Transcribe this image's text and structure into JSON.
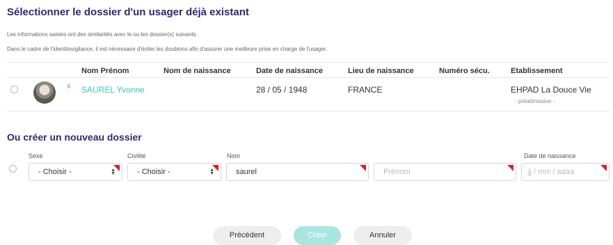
{
  "select_section": {
    "title": "Sélectionner le dossier d'un usager déjà existant",
    "info_line1": "Les informations saisies ont des similarités avec le ou les dossier(s) suivants.",
    "info_line2": "Dans le cadre de l'identitovigilance, il est nécessaire d'éviter les doublons afin d'assurer une meilleure prise en charge de l'usager."
  },
  "table": {
    "headers": [
      "Nom Prénom",
      "Nom de naissance",
      "Date de naissance",
      "Lieu de naissance",
      "Numéro sécu.",
      "Etablissement"
    ],
    "rows": [
      {
        "gender_icon": "female-icon",
        "name": "SAUREL Yvonne",
        "birth_name": "",
        "birth_date": "28 / 05 / 1948",
        "birth_place": "FRANCE",
        "ssn": "",
        "establishment": "EHPAD La Douce Vie",
        "establishment_status": "- préadmission -"
      }
    ]
  },
  "create_section": {
    "title": "Ou créer un nouveau dossier",
    "sexe_label": "Sexe",
    "sexe_value": "- Choisir -",
    "civilite_label": "Civilité",
    "civilite_value": "- Choisir -",
    "nom_label": "Nom",
    "nom_value": "saurel",
    "prenom_placeholder": "Prénom",
    "birth_label": "Date de naissance",
    "birth_placeholder": "jj / mm / aaaa"
  },
  "buttons": {
    "previous": "Précédent",
    "create": "Créer",
    "cancel": "Annuler"
  },
  "colors": {
    "title": "#2b2a6e",
    "link": "#3cc5b4",
    "required_marker": "#d91e2b",
    "create_button": "#a8e6df"
  }
}
